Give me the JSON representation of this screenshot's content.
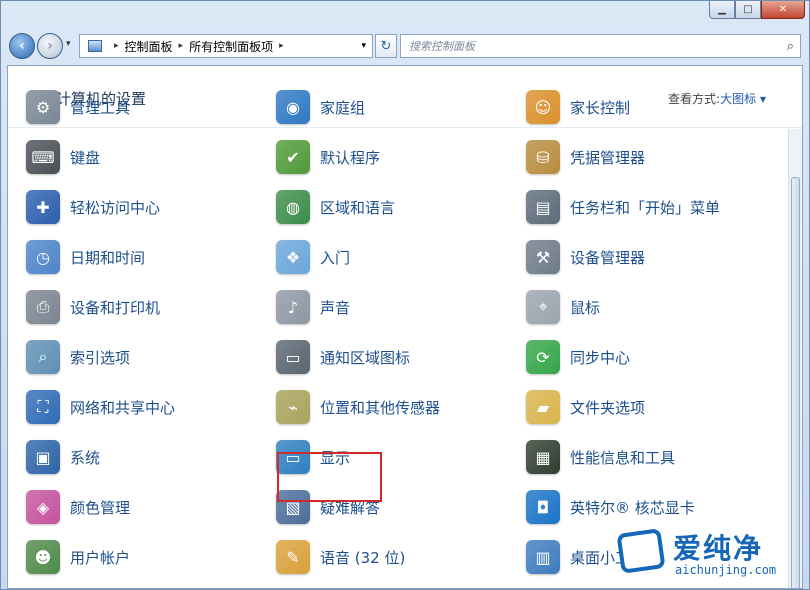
{
  "window": {
    "minimize": "▁",
    "maximize": "□",
    "close": "✕"
  },
  "navigation": {
    "back": "‹",
    "forward": "›",
    "history": "▾",
    "breadcrumb": [
      "控制面板",
      "所有控制面板项"
    ],
    "breadcrumb_separator": "▸",
    "address_dropdown": "▾",
    "refresh": "↻",
    "search_placeholder": "搜索控制面板",
    "search_icon": "⌕"
  },
  "header": {
    "title": "调整计算机的设置",
    "view_by_label": "查看方式:",
    "view_by_value": "大图标 ▾"
  },
  "items": [
    {
      "label": "管理工具",
      "icon": "tools-icon",
      "color": "#7a8795",
      "glyph": "⚙"
    },
    {
      "label": "家庭组",
      "icon": "homegroup-icon",
      "color": "#2f78c4",
      "glyph": "◉"
    },
    {
      "label": "家长控制",
      "icon": "parental-controls-icon",
      "color": "#d9902a",
      "glyph": "☺"
    },
    {
      "label": "键盘",
      "icon": "keyboard-icon",
      "color": "#4a4f57",
      "glyph": "⌨"
    },
    {
      "label": "默认程序",
      "icon": "default-programs-icon",
      "color": "#4f9a38",
      "glyph": "✔"
    },
    {
      "label": "凭据管理器",
      "icon": "credential-manager-icon",
      "color": "#b98b3f",
      "glyph": "⛁"
    },
    {
      "label": "轻松访问中心",
      "icon": "ease-of-access-icon",
      "color": "#2b5fad",
      "glyph": "✚"
    },
    {
      "label": "区域和语言",
      "icon": "region-language-icon",
      "color": "#3c8d4a",
      "glyph": "◍"
    },
    {
      "label": "任务栏和「开始」菜单",
      "icon": "taskbar-icon",
      "color": "#5c6b7a",
      "glyph": "▤"
    },
    {
      "label": "日期和时间",
      "icon": "date-time-icon",
      "color": "#4d84c9",
      "glyph": "◷"
    },
    {
      "label": "入门",
      "icon": "getting-started-icon",
      "color": "#6aa6d9",
      "glyph": "❖"
    },
    {
      "label": "设备管理器",
      "icon": "device-manager-icon",
      "color": "#6e7b88",
      "glyph": "⚒"
    },
    {
      "label": "设备和打印机",
      "icon": "devices-printers-icon",
      "color": "#7b8490",
      "glyph": "⎙"
    },
    {
      "label": "声音",
      "icon": "sound-icon",
      "color": "#8d97a3",
      "glyph": "♪"
    },
    {
      "label": "鼠标",
      "icon": "mouse-icon",
      "color": "#9aa4ae",
      "glyph": "⌖"
    },
    {
      "label": "索引选项",
      "icon": "indexing-options-icon",
      "color": "#5e8fb4",
      "glyph": "⌕"
    },
    {
      "label": "通知区域图标",
      "icon": "notification-area-icon",
      "color": "#5a6570",
      "glyph": "▭"
    },
    {
      "label": "同步中心",
      "icon": "sync-center-icon",
      "color": "#35a54a",
      "glyph": "⟳"
    },
    {
      "label": "网络和共享中心",
      "icon": "network-sharing-icon",
      "color": "#2f6bb5",
      "glyph": "⛶"
    },
    {
      "label": "位置和其他传感器",
      "icon": "location-sensors-icon",
      "color": "#a8a35a",
      "glyph": "⌁"
    },
    {
      "label": "文件夹选项",
      "icon": "folder-options-icon",
      "color": "#d9b44a",
      "glyph": "▰"
    },
    {
      "label": "系统",
      "icon": "system-icon",
      "color": "#2e64a6",
      "glyph": "▣"
    },
    {
      "label": "显示",
      "icon": "display-icon",
      "color": "#2e7fc0",
      "glyph": "▭"
    },
    {
      "label": "性能信息和工具",
      "icon": "performance-icon",
      "color": "#2f3d2f",
      "glyph": "▦"
    },
    {
      "label": "颜色管理",
      "icon": "color-management-icon",
      "color": "#c4539d",
      "glyph": "◈"
    },
    {
      "label": "疑难解答",
      "icon": "troubleshooting-icon",
      "color": "#4a6e9a",
      "glyph": "▧"
    },
    {
      "label": "英特尔® 核芯显卡",
      "icon": "intel-graphics-icon",
      "color": "#1a73c7",
      "glyph": "◘"
    },
    {
      "label": "用户帐户",
      "icon": "user-accounts-icon",
      "color": "#4f8a4a",
      "glyph": "☻"
    },
    {
      "label": "语音 (32 位)",
      "icon": "speech-icon",
      "color": "#d9a03a",
      "glyph": "✎"
    },
    {
      "label": "桌面小工具",
      "icon": "desktop-gadgets-icon",
      "color": "#3e7cbf",
      "glyph": "▥"
    }
  ],
  "watermark": {
    "title": "爱纯净",
    "subtitle": "aichunjing.com"
  }
}
